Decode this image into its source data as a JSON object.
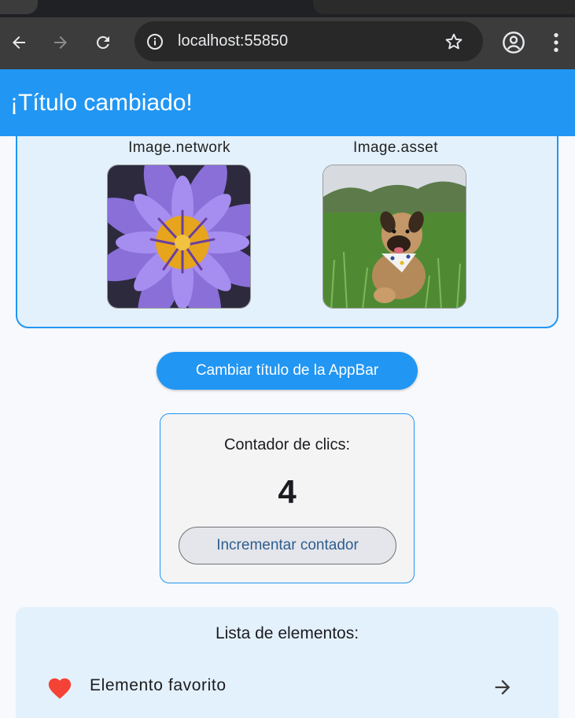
{
  "browser": {
    "url": "localhost:55850",
    "icons": {
      "back": "arrow-back-icon",
      "forward": "arrow-forward-icon",
      "reload": "reload-icon",
      "info": "info-icon",
      "bookmark": "star-icon",
      "profile": "profile-icon",
      "menu": "more-vert-icon"
    }
  },
  "appbar": {
    "title": "¡Título cambiado!",
    "color": "#2196f3"
  },
  "images": [
    {
      "label": "Image.network",
      "content": "purple water lily flower close-up"
    },
    {
      "label": "Image.asset",
      "content": "dog sitting in grass wearing bandana"
    }
  ],
  "change_title_button": {
    "label": "Cambiar título de la AppBar"
  },
  "counter": {
    "heading": "Contador de clics:",
    "value": "4",
    "button_label": "Incrementar contador"
  },
  "list": {
    "heading": "Lista de elementos:",
    "items": [
      {
        "label": "Elemento favorito",
        "icon": "heart-icon",
        "icon_color": "#f44336",
        "trailing_icon": "arrow-forward-icon"
      }
    ]
  }
}
